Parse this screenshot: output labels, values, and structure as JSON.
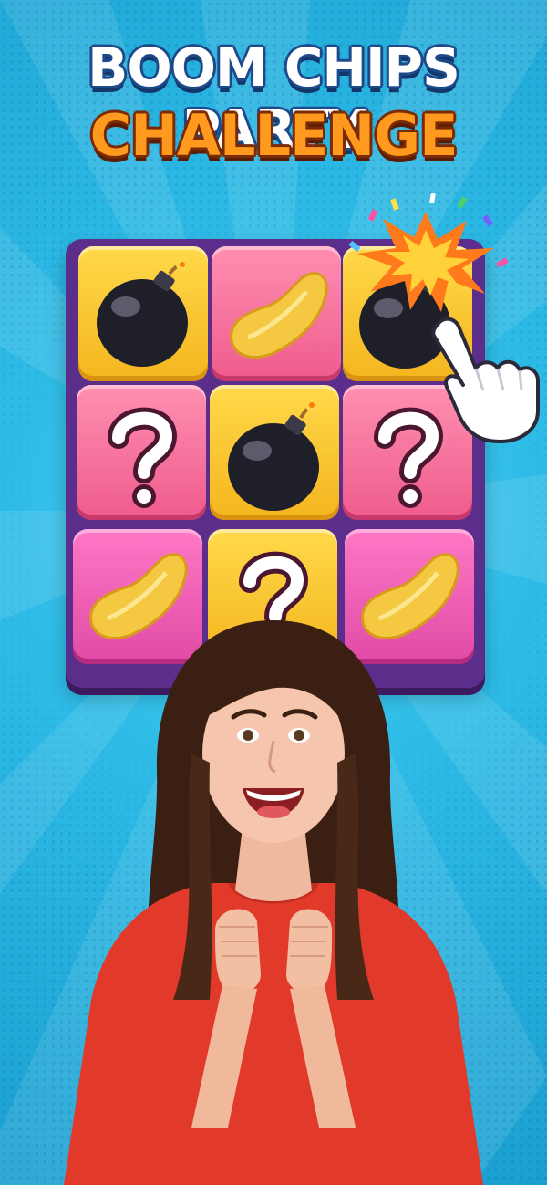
{
  "title": {
    "line1": "BOOM CHIPS PARTY",
    "line2": "CHALLENGE"
  },
  "colors": {
    "background": "#27b4e0",
    "title_line1": "#ffffff",
    "title_line2": "#ff9a1f",
    "board": "#5b2e8c"
  },
  "board": {
    "rows": 3,
    "cols": 3,
    "tiles": [
      {
        "row": 1,
        "col": 1,
        "color": "yellow",
        "content": "bomb"
      },
      {
        "row": 1,
        "col": 2,
        "color": "pink",
        "content": "chip"
      },
      {
        "row": 1,
        "col": 3,
        "color": "yellow",
        "content": "bomb",
        "state": "exploding"
      },
      {
        "row": 2,
        "col": 1,
        "color": "pink",
        "content": "question"
      },
      {
        "row": 2,
        "col": 2,
        "color": "yellow",
        "content": "bomb"
      },
      {
        "row": 2,
        "col": 3,
        "color": "pink",
        "content": "question"
      },
      {
        "row": 3,
        "col": 1,
        "color": "magenta",
        "content": "chip"
      },
      {
        "row": 3,
        "col": 2,
        "color": "yellow",
        "content": "question"
      },
      {
        "row": 3,
        "col": 3,
        "color": "magenta",
        "content": "chip"
      }
    ]
  },
  "icons": {
    "pointer": "pointing-hand-icon",
    "explosion": "explosion-icon"
  },
  "character": "excited-woman-red-shirt"
}
